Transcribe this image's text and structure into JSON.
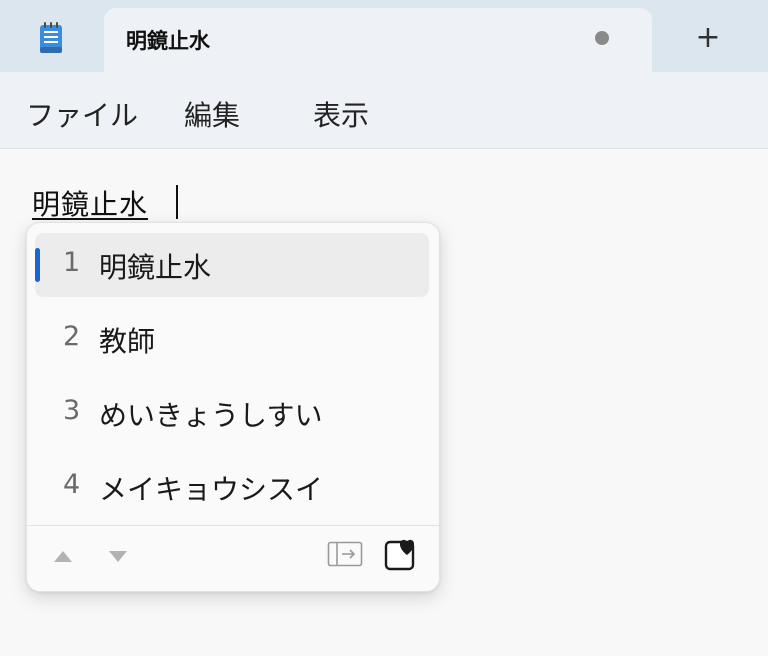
{
  "window": {
    "app_icon": "notepad-icon",
    "tab_title": "明鏡止水",
    "tab_unsaved_indicator": "dot",
    "new_tab_label": "+"
  },
  "menu": {
    "items": [
      "ファイル",
      "編集",
      "表示"
    ]
  },
  "editor": {
    "composing_text": "明鏡止水"
  },
  "ime": {
    "candidates": [
      {
        "number": "1",
        "text": "明鏡止水",
        "selected": true
      },
      {
        "number": "2",
        "text": "教師",
        "selected": false
      },
      {
        "number": "3",
        "text": "めいきょうしすい",
        "selected": false
      },
      {
        "number": "4",
        "text": "メイキョウシスイ",
        "selected": false
      }
    ],
    "footer_icons": [
      "arrow-up-icon",
      "arrow-down-icon",
      "expand-panel-icon",
      "emoji-favorite-icon"
    ]
  },
  "colors": {
    "accent": "#1a66c9",
    "titlebar": "#dce6ef",
    "tab": "#eef2f7",
    "editor_bg": "#f8f8f8"
  }
}
